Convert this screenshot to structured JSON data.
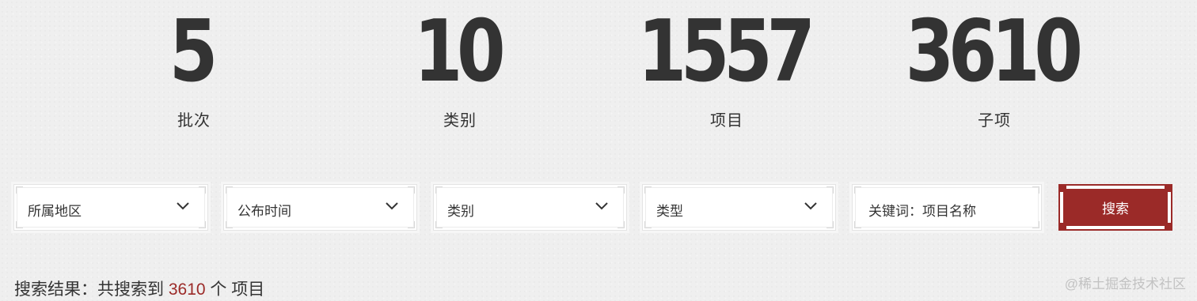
{
  "stats": [
    {
      "value": "5",
      "label": "批次"
    },
    {
      "value": "10",
      "label": "类别"
    },
    {
      "value": "1557",
      "label": "项目"
    },
    {
      "value": "3610",
      "label": "子项"
    }
  ],
  "filters": {
    "region": {
      "value": "所属地区",
      "icon": "chevron-down-icon"
    },
    "publish_time": {
      "value": "公布时间",
      "icon": "chevron-down-icon"
    },
    "category": {
      "value": "类别",
      "icon": "chevron-down-icon"
    },
    "type": {
      "value": "类型",
      "icon": "chevron-down-icon"
    },
    "keyword": {
      "placeholder": "关键词：项目名称"
    }
  },
  "search_button": {
    "label": "搜索"
  },
  "result": {
    "prefix": "搜索结果：共搜索到 ",
    "count": "3610",
    "suffix": " 个 项目"
  },
  "watermark": "@稀土掘金技术社区",
  "colors": {
    "accent": "#9b2a28",
    "text": "#333333",
    "background": "#efefef"
  }
}
